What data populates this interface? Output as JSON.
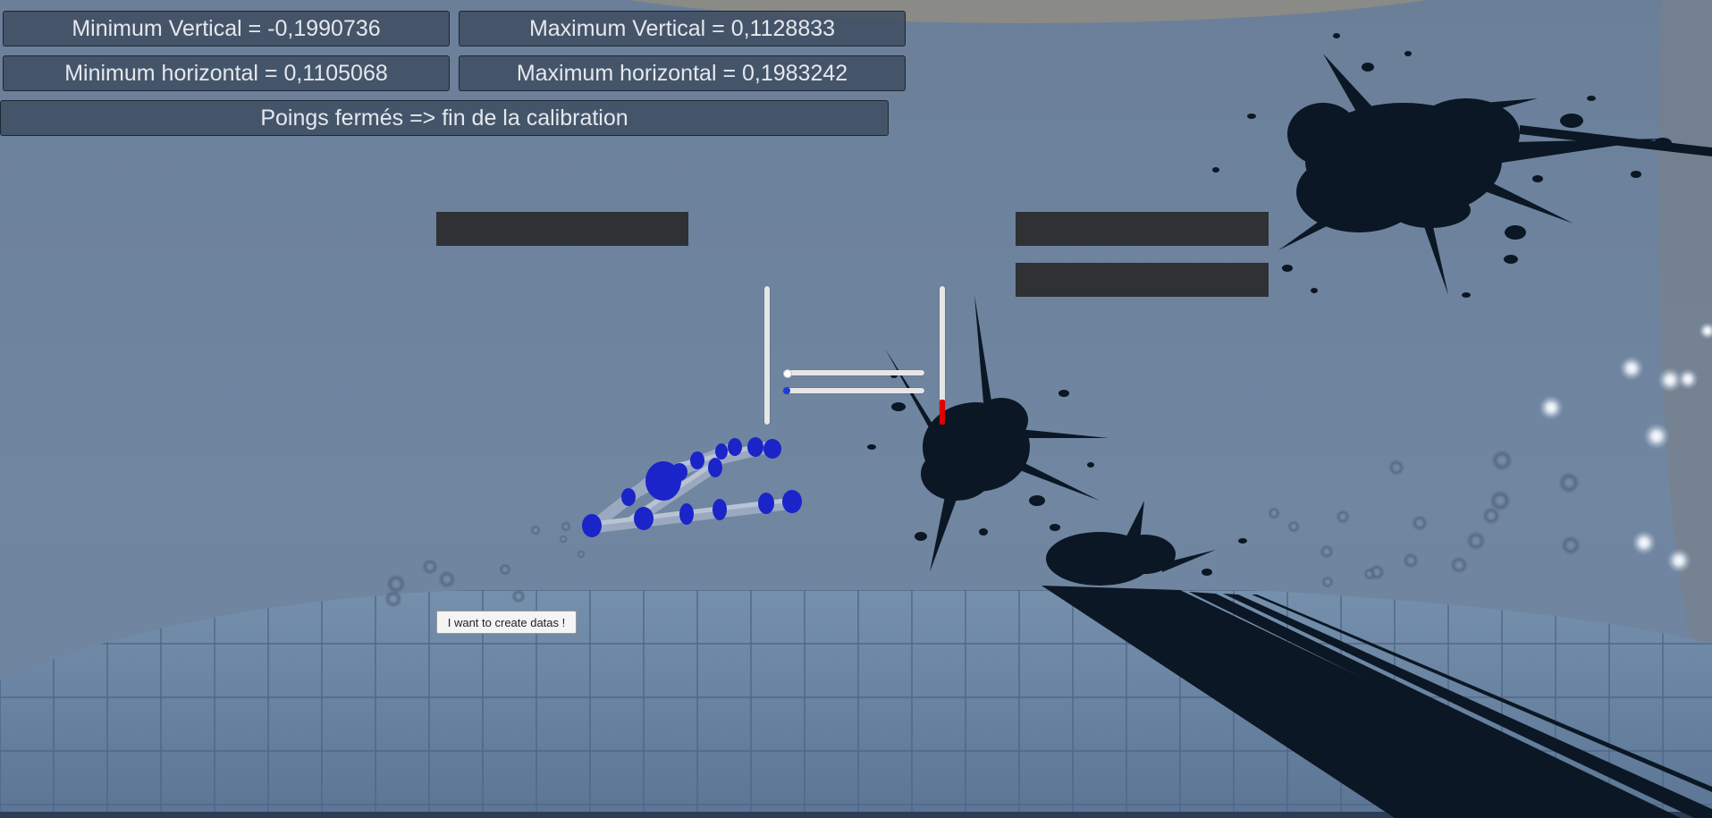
{
  "calibration": {
    "min_vertical": "Minimum Vertical = -0,1990736",
    "max_vertical": "Maximum Vertical = 0,1128833",
    "min_horizontal": "Minimum horizontal = 0,1105068",
    "max_horizontal": "Maximum horizontal = 0,1983242",
    "instruction": "Poings fermés => fin de la calibration"
  },
  "buttons": {
    "create_data_label": "I want to create datas !"
  },
  "sliders": {
    "vertical_left": {
      "value": 0.0
    },
    "vertical_right": {
      "value": 0.18
    },
    "horizontal_top": {
      "value": 0.0
    },
    "horizontal_bottom": {
      "value": 0.0
    }
  },
  "colors": {
    "panel_bg": "#404e62",
    "panel_text": "#e4e8ee",
    "dark_bar": "#2f3134",
    "slider_fill": "#e00000",
    "hand_joint": "#1a24c8",
    "ink": "#0b1724"
  }
}
